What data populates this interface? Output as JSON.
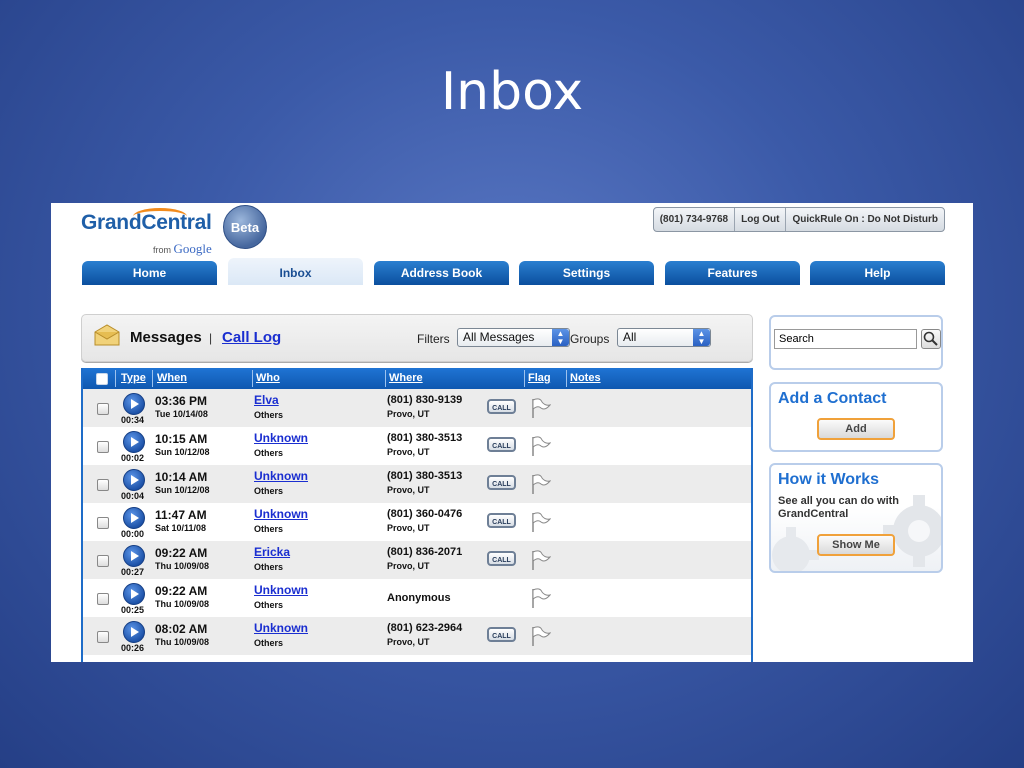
{
  "slide": {
    "title": "Inbox"
  },
  "brand": {
    "name": "GrandCentral",
    "from": "from",
    "google": "Google",
    "badge": "Beta"
  },
  "top_buttons": {
    "phone": "(801) 734-9768",
    "logout": "Log Out",
    "quickrule": "QuickRule On : Do Not Disturb"
  },
  "nav": {
    "tabs": [
      "Home",
      "Inbox",
      "Address Book",
      "Settings",
      "Features",
      "Help"
    ],
    "active": "Inbox"
  },
  "messages_header": {
    "title": "Messages",
    "separator": "|",
    "call_log": "Call Log",
    "filters_label": "Filters",
    "filter_value": "All Messages",
    "groups_label": "Groups",
    "groups_value": "All"
  },
  "table": {
    "columns": [
      "Type",
      "When",
      "Who",
      "Where",
      "Flag",
      "Notes"
    ],
    "call_label": "CALL",
    "rows": [
      {
        "duration": "00:34",
        "time": "03:36 PM",
        "date": "Tue 10/14/08",
        "who": "Elva",
        "group": "Others",
        "phone": "(801) 830-9139",
        "location": "Provo, UT"
      },
      {
        "duration": "00:02",
        "time": "10:15 AM",
        "date": "Sun 10/12/08",
        "who": "Unknown",
        "group": "Others",
        "phone": "(801) 380-3513",
        "location": "Provo, UT"
      },
      {
        "duration": "00:04",
        "time": "10:14 AM",
        "date": "Sun 10/12/08",
        "who": "Unknown",
        "group": "Others",
        "phone": "(801) 380-3513",
        "location": "Provo, UT"
      },
      {
        "duration": "00:00",
        "time": "11:47 AM",
        "date": "Sat 10/11/08",
        "who": "Unknown",
        "group": "Others",
        "phone": "(801) 360-0476",
        "location": "Provo, UT"
      },
      {
        "duration": "00:27",
        "time": "09:22 AM",
        "date": "Thu 10/09/08",
        "who": "Ericka",
        "group": "Others",
        "phone": "(801) 836-2071",
        "location": "Provo, UT"
      },
      {
        "duration": "00:25",
        "time": "09:22 AM",
        "date": "Thu 10/09/08",
        "who": "Unknown",
        "group": "Others",
        "phone": "Anonymous",
        "location": ""
      },
      {
        "duration": "00:26",
        "time": "08:02 AM",
        "date": "Thu 10/09/08",
        "who": "Unknown",
        "group": "Others",
        "phone": "(801) 623-2964",
        "location": "Provo, UT"
      }
    ]
  },
  "sidebar": {
    "search_value": "Search",
    "add_contact": {
      "title": "Add a Contact",
      "button": "Add"
    },
    "how_it_works": {
      "title": "How it Works",
      "description": "See all you can do with GrandCentral",
      "button": "Show Me"
    }
  },
  "colors": {
    "background": "#3b5aa8",
    "nav_blue": "#0b4f9e",
    "link": "#1a2ed0",
    "accent_orange": "#f0a13a"
  },
  "icons": [
    "envelope-icon",
    "play-icon",
    "flag-icon",
    "magnifier-icon",
    "gear-icon"
  ]
}
